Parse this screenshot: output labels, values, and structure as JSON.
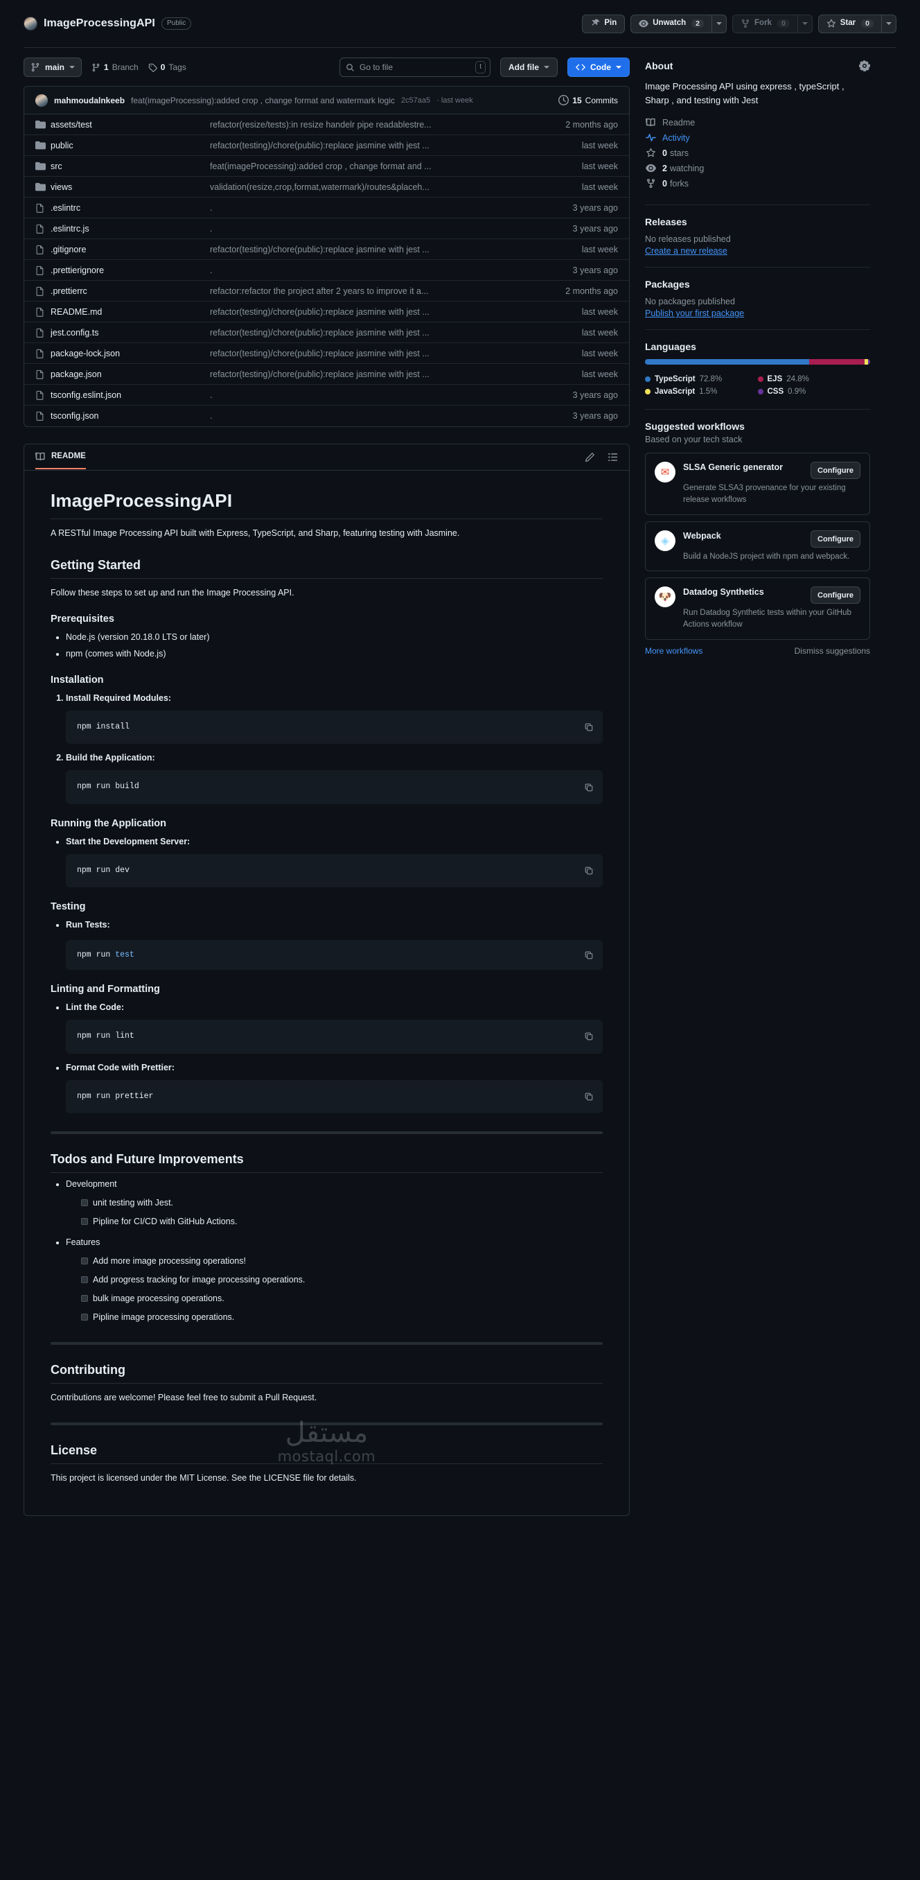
{
  "header": {
    "repo_name": "ImageProcessingAPI",
    "visibility": "Public",
    "pin_label": "Pin",
    "watch_label": "Unwatch",
    "watch_count": "2",
    "fork_label": "Fork",
    "fork_count": "0",
    "star_label": "Star",
    "star_count": "0"
  },
  "file_toolbar": {
    "branch": "main",
    "branch_count": "1",
    "branch_word": "Branch",
    "tag_count": "0",
    "tag_word": "Tags",
    "search_placeholder": "Go to file",
    "search_kbd": "t",
    "add_file": "Add file",
    "code": "Code"
  },
  "commit_bar": {
    "author": "mahmoudalnkeeb",
    "message": "feat(imageProcessing):added crop , change format and watermark logic",
    "sha": "2c57aa5",
    "time": "last week",
    "commits_count": "15",
    "commits_label": "Commits"
  },
  "files": [
    {
      "name": "assets/test",
      "type": "folder",
      "commit": "refactor(resize/tests):in resize handelr pipe readablestre...",
      "time": "2 months ago"
    },
    {
      "name": "public",
      "type": "folder",
      "commit": "refactor(testing)/chore(public):replace jasmine with jest ...",
      "time": "last week"
    },
    {
      "name": "src",
      "type": "folder",
      "commit": "feat(imageProcessing):added crop , change format and ...",
      "time": "last week"
    },
    {
      "name": "views",
      "type": "folder",
      "commit": "validation(resize,crop,format,watermark)/routes&placeh...",
      "time": "last week"
    },
    {
      "name": ".eslintrc",
      "type": "file",
      "commit": ".",
      "time": "3 years ago"
    },
    {
      "name": ".eslintrc.js",
      "type": "file",
      "commit": ".",
      "time": "3 years ago"
    },
    {
      "name": ".gitignore",
      "type": "file",
      "commit": "refactor(testing)/chore(public):replace jasmine with jest ...",
      "time": "last week"
    },
    {
      "name": ".prettierignore",
      "type": "file",
      "commit": ".",
      "time": "3 years ago"
    },
    {
      "name": ".prettierrc",
      "type": "file",
      "commit": "refactor:refactor the project after 2 years to improve it a...",
      "time": "2 months ago"
    },
    {
      "name": "README.md",
      "type": "file",
      "commit": "refactor(testing)/chore(public):replace jasmine with jest ...",
      "time": "last week"
    },
    {
      "name": "jest.config.ts",
      "type": "file",
      "commit": "refactor(testing)/chore(public):replace jasmine with jest ...",
      "time": "last week"
    },
    {
      "name": "package-lock.json",
      "type": "file",
      "commit": "refactor(testing)/chore(public):replace jasmine with jest ...",
      "time": "last week"
    },
    {
      "name": "package.json",
      "type": "file",
      "commit": "refactor(testing)/chore(public):replace jasmine with jest ...",
      "time": "last week"
    },
    {
      "name": "tsconfig.eslint.json",
      "type": "file",
      "commit": ".",
      "time": "3 years ago"
    },
    {
      "name": "tsconfig.json",
      "type": "file",
      "commit": ".",
      "time": "3 years ago"
    }
  ],
  "readme": {
    "tab_label": "README",
    "title": "ImageProcessingAPI",
    "intro": "A RESTful Image Processing API built with Express, TypeScript, and Sharp, featuring testing with Jasmine.",
    "getting_started": {
      "heading": "Getting Started",
      "text": "Follow these steps to set up and run the Image Processing API."
    },
    "prerequisites": {
      "heading": "Prerequisites",
      "items": [
        "Node.js (version 20.18.0 LTS or later)",
        "npm (comes with Node.js)"
      ]
    },
    "installation": {
      "heading": "Installation",
      "steps": [
        {
          "label": "Install Required Modules:",
          "code": "npm install"
        },
        {
          "label": "Build the Application:",
          "code": "npm run build"
        }
      ]
    },
    "running": {
      "heading": "Running the Application",
      "steps": [
        {
          "label": "Start the Development Server:",
          "code": "npm run dev"
        }
      ]
    },
    "testing": {
      "heading": "Testing",
      "label": "Run Tests:",
      "code_plain": "npm run ",
      "code_token": "test"
    },
    "linting": {
      "heading": "Linting and Formatting",
      "steps": [
        {
          "label": "Lint the Code:",
          "code": "npm run lint"
        },
        {
          "label": "Format Code with Prettier:",
          "code": "npm run prettier"
        }
      ]
    },
    "todos": {
      "heading": "Todos and Future Improvements",
      "groups": [
        {
          "name": "Development",
          "items": [
            "unit testing with Jest.",
            "Pipline for CI/CD with GitHub Actions."
          ]
        },
        {
          "name": "Features",
          "items": [
            "Add more image processing operations!",
            "Add progress tracking for image processing operations.",
            "bulk image processing operations.",
            "Pipline image processing operations."
          ]
        }
      ]
    },
    "contributing": {
      "heading": "Contributing",
      "text": "Contributions are welcome! Please feel free to submit a Pull Request."
    },
    "license": {
      "heading": "License",
      "text": "This project is licensed under the MIT License. See the LICENSE file for details."
    },
    "watermark_ar": "مستقل",
    "watermark_en": "mostaql.com"
  },
  "sidebar": {
    "about": {
      "heading": "About",
      "description": "Image Processing API using express , typeScript , Sharp , and testing with Jest",
      "links": [
        {
          "label": "Readme",
          "icon": "book-icon"
        },
        {
          "label": "Activity",
          "icon": "pulse-icon"
        }
      ],
      "stats": [
        {
          "count": "0",
          "label": "stars",
          "icon": "star-icon"
        },
        {
          "count": "2",
          "label": "watching",
          "icon": "eye-icon"
        },
        {
          "count": "0",
          "label": "forks",
          "icon": "fork-icon"
        }
      ]
    },
    "releases": {
      "heading": "Releases",
      "empty": "No releases published",
      "link": "Create a new release"
    },
    "packages": {
      "heading": "Packages",
      "empty": "No packages published",
      "link": "Publish your first package"
    },
    "languages": {
      "heading": "Languages",
      "items": [
        {
          "name": "TypeScript",
          "pct": "72.8%",
          "value": 72.8,
          "color": "#3178c6"
        },
        {
          "name": "EJS",
          "pct": "24.8%",
          "value": 24.8,
          "color": "#a91e50"
        },
        {
          "name": "JavaScript",
          "pct": "1.5%",
          "value": 1.5,
          "color": "#f1e05a"
        },
        {
          "name": "CSS",
          "pct": "0.9%",
          "value": 0.9,
          "color": "#663399"
        }
      ]
    },
    "workflows": {
      "heading": "Suggested workflows",
      "subheading": "Based on your tech stack",
      "configure_label": "Configure",
      "cards": [
        {
          "title": "SLSA Generic generator",
          "desc": "Generate SLSA3 provenance for your existing release workflows",
          "glyph": "✉",
          "color": "#ea4b35"
        },
        {
          "title": "Webpack",
          "desc": "Build a NodeJS project with npm and webpack.",
          "glyph": "◈",
          "color": "#8ed6fb"
        },
        {
          "title": "Datadog Synthetics",
          "desc": "Run Datadog Synthetic tests within your GitHub Actions workflow",
          "glyph": "🐶",
          "color": "#632ca6"
        }
      ],
      "more_link": "More workflows",
      "dismiss": "Dismiss suggestions"
    }
  }
}
